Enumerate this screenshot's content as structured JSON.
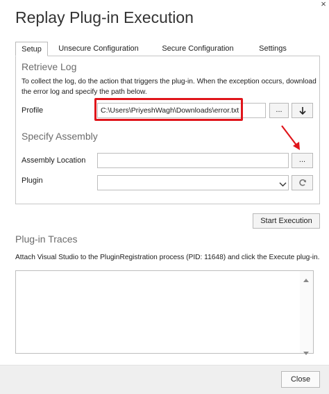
{
  "window": {
    "title": "Replay Plug-in Execution",
    "close_glyph": "×"
  },
  "tabs": [
    {
      "label": "Setup",
      "active": true
    },
    {
      "label": "Unsecure Configuration",
      "active": false
    },
    {
      "label": "Secure Configuration",
      "active": false
    },
    {
      "label": "Settings",
      "active": false
    }
  ],
  "retrieve_log": {
    "title": "Retrieve Log",
    "description": "To collect the log, do the action that triggers the plug-in. When the exception occurs, download the error log and specify the path below.",
    "profile_label": "Profile",
    "profile_value": "C:\\Users\\PriyeshWagh\\Downloads\\error.txt",
    "browse_label": "...",
    "download_icon": "arrow-down-icon"
  },
  "specify_assembly": {
    "title": "Specify Assembly",
    "assembly_label": "Assembly Location",
    "assembly_value": "",
    "browse_label": "...",
    "plugin_label": "Plugin",
    "plugin_value": "",
    "refresh_icon": "refresh-icon"
  },
  "start_execution_label": "Start Execution",
  "traces": {
    "title": "Plug-in Traces",
    "instruction": "Attach Visual Studio to the PluginRegistration process (PID: 11648) and click the Execute plug-in."
  },
  "footer": {
    "close_label": "Close"
  },
  "colors": {
    "highlight": "#e0151b",
    "annotation_arrow": "#e0151b"
  }
}
